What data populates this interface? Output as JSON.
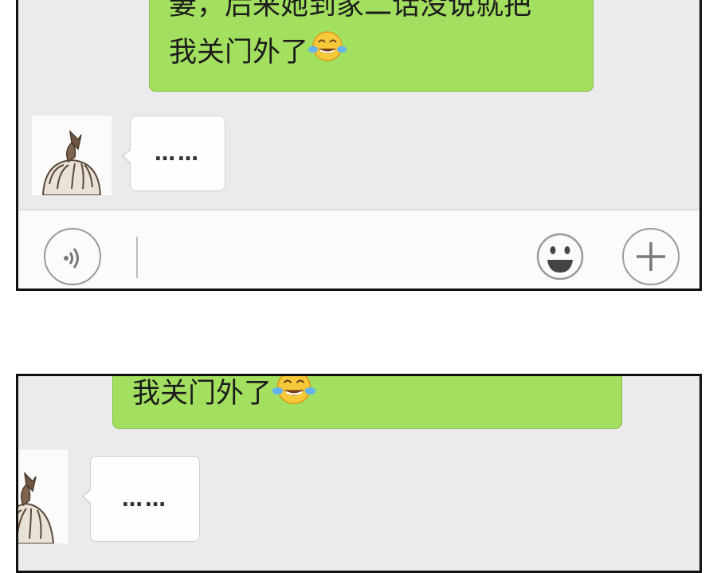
{
  "panels": [
    {
      "sent_message": {
        "line1": "妻，后来她到家二话没说就把",
        "line2": "我关门外了",
        "emoji": "tears-of-joy-emoji"
      },
      "received_message": {
        "text": "……"
      },
      "input_bar": {
        "voice_icon": "voice-icon",
        "emoji_icon": "smiley-icon",
        "plus_icon": "plus-icon"
      }
    },
    {
      "sent_message": {
        "line2": "我关门外了",
        "emoji": "tears-of-joy-emoji"
      },
      "received_message": {
        "text": "……"
      }
    }
  ],
  "colors": {
    "sent_bubble": "#a3e05f",
    "chat_background": "#ebebeb",
    "received_bubble": "#fefefe"
  }
}
